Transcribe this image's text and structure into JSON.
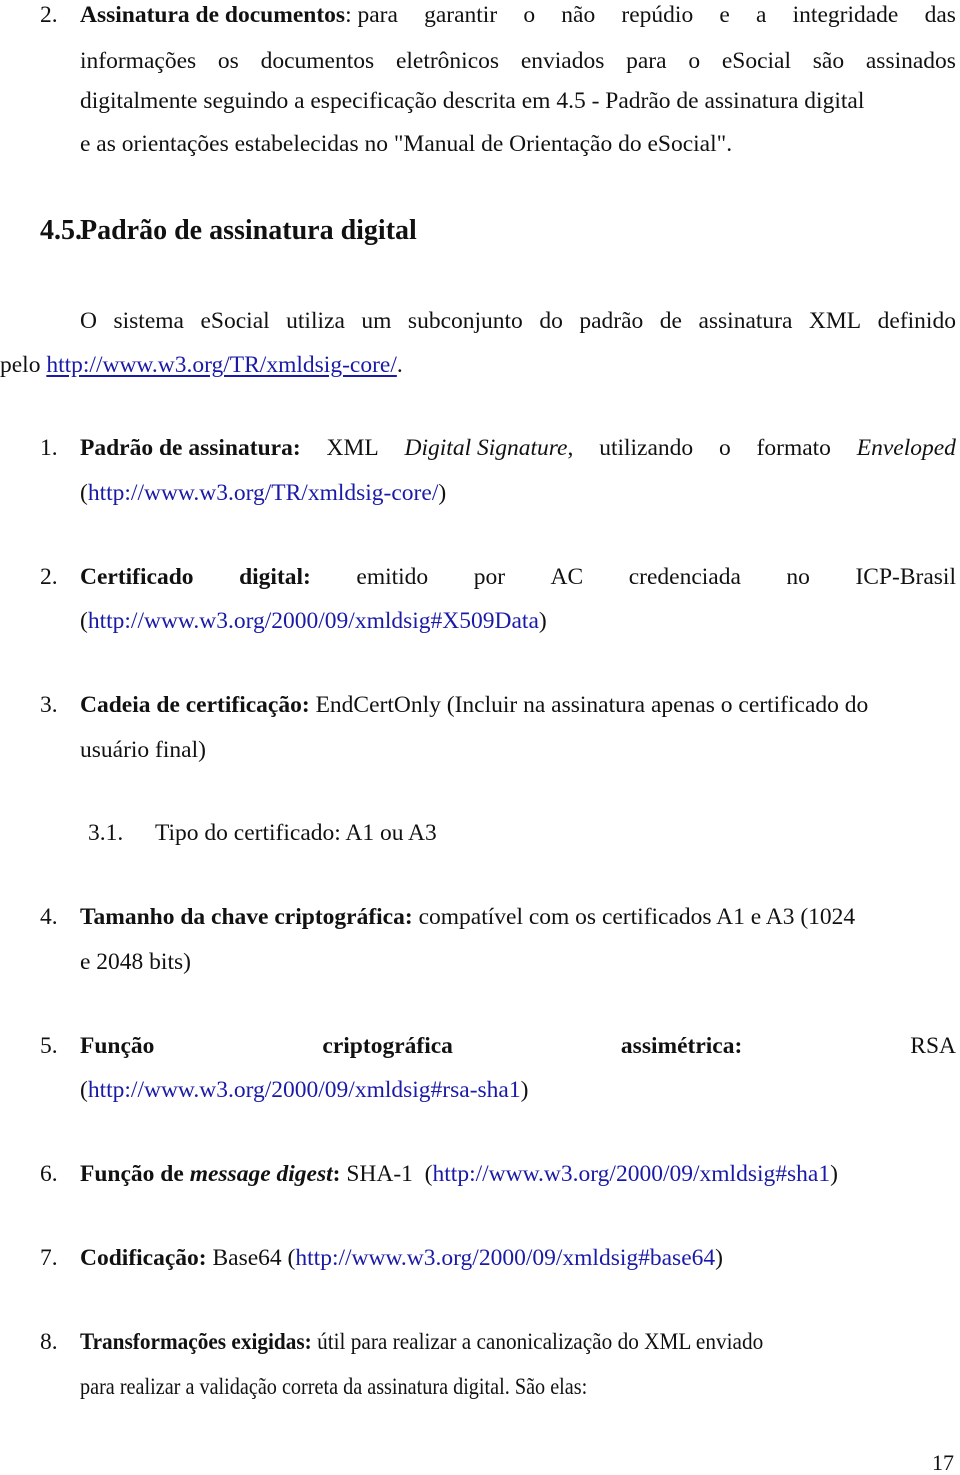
{
  "intro_item": {
    "number": "2.",
    "title": "Assinatura de documentos",
    "lines": [
      [
        ": para",
        "garantir",
        "o",
        "não",
        "repúdio",
        "e",
        "a",
        "integridade",
        "das"
      ],
      [
        "informações",
        "os",
        "documentos",
        "eletrônicos",
        "enviados",
        "para",
        "o",
        "eSocial",
        "são",
        "assinados"
      ],
      "digitalmente seguindo a especificação descrita em 4.5 - Padrão de assinatura digital",
      "e as orientações estabelecidas no \"Manual de Orientação do eSocial\"."
    ]
  },
  "section": {
    "number": "4.5.",
    "title": "Padrão de assinatura digital",
    "para_line1": [
      "O",
      "sistema",
      "eSocial",
      "utiliza",
      "um",
      "subconjunto",
      "do",
      "padrão",
      "de",
      "assinatura",
      "XML",
      "definido"
    ],
    "para_line2_prefix": "pelo ",
    "para_link": "http://www.w3.org/TR/xmldsig-core/",
    "para_line2_suffix": "."
  },
  "items": [
    {
      "number": "1.",
      "label": "Padrão de assinatura:",
      "text_a": " XML ",
      "italic_a": "Digital Signature",
      "text_b": ", utilizando o formato ",
      "italic_b": "Enveloped",
      "link": "http://www.w3.org/TR/xmldsig-core/"
    },
    {
      "number": "2.",
      "label_words": [
        "Certificado",
        "digital:"
      ],
      "words": [
        "emitido",
        "por",
        "AC",
        "credenciada",
        "no",
        "ICP-Brasil"
      ],
      "link": "http://www.w3.org/2000/09/xmldsig#X509Data"
    },
    {
      "number": "3.",
      "label": "Cadeia de certificação:",
      "text": " EndCertOnly (Incluir na assinatura apenas o certificado do",
      "text2": "usuário final)",
      "sub": {
        "number": "3.1.",
        "text": "Tipo do certificado: A1 ou A3"
      }
    },
    {
      "number": "4.",
      "label": "Tamanho da chave criptográfica:",
      "text": " compatível com os certificados A1 e A3 (1024",
      "text2": "e 2048 bits)"
    },
    {
      "number": "5.",
      "label_words": [
        "Função",
        "criptográfica",
        "assimétrica:"
      ],
      "words": [
        "RSA"
      ],
      "link": "http://www.w3.org/2000/09/xmldsig#rsa-sha1"
    },
    {
      "number": "6.",
      "label_a": "Função de ",
      "label_italic": "message digest",
      "label_b": ":",
      "text": " SHA-1  (",
      "link": "http://www.w3.org/2000/09/xmldsig#sha1",
      "close": ")"
    },
    {
      "number": "7.",
      "label": "Codificação:",
      "text": " Base64 (",
      "link": "http://www.w3.org/2000/09/xmldsig#base64",
      "close": ")"
    },
    {
      "number": "8.",
      "label": "Transformações exigidas:",
      "text": " útil para realizar a canonicalização do XML enviado",
      "text2": "para realizar a validação correta da assinatura digital. São elas:"
    }
  ],
  "page_number": "17",
  "colors": {
    "link": "#1a1aa8",
    "text": "#111111"
  }
}
